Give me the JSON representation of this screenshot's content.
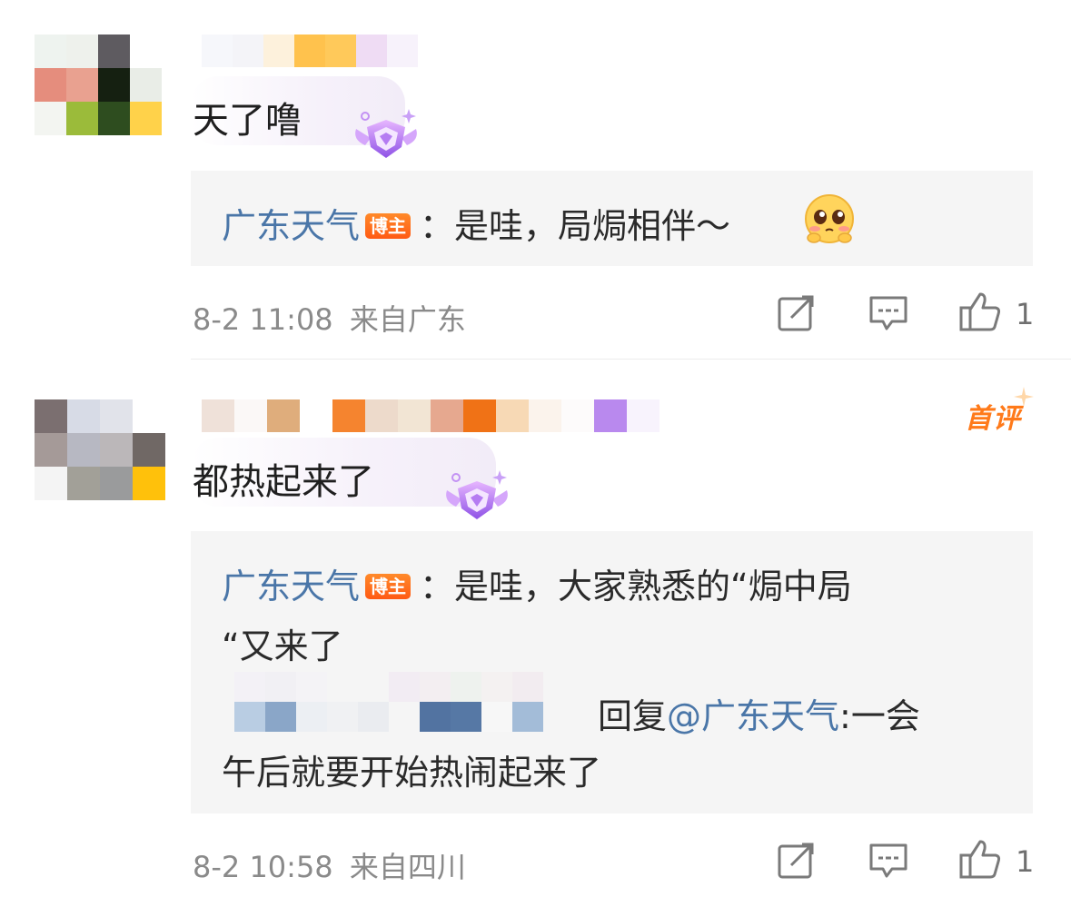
{
  "comments": [
    {
      "text": "天了噜",
      "reply": {
        "author": "广东天气",
        "badge": "博主",
        "text": "：是哇，局焗相伴～"
      },
      "time": "8-2 11:08",
      "location": "来自广东",
      "likes": "1"
    },
    {
      "tag": "首评",
      "text": "都热起来了",
      "reply": {
        "author": "广东天气",
        "badge": "博主",
        "line1": "：是哇，大家熟悉的“焗中局",
        "line2": "“又来了"
      },
      "nested_reply": {
        "reply_word": "回复",
        "mention": "@广东天气",
        "text_after": ":一会",
        "line2": "午后就要开始热闹起来了"
      },
      "time": "8-2 10:58",
      "location": "来自四川",
      "likes": "1"
    }
  ],
  "icons": [
    "share-icon",
    "comment-icon",
    "like-icon",
    "fan-badge-icon",
    "blush-emoji-icon"
  ]
}
